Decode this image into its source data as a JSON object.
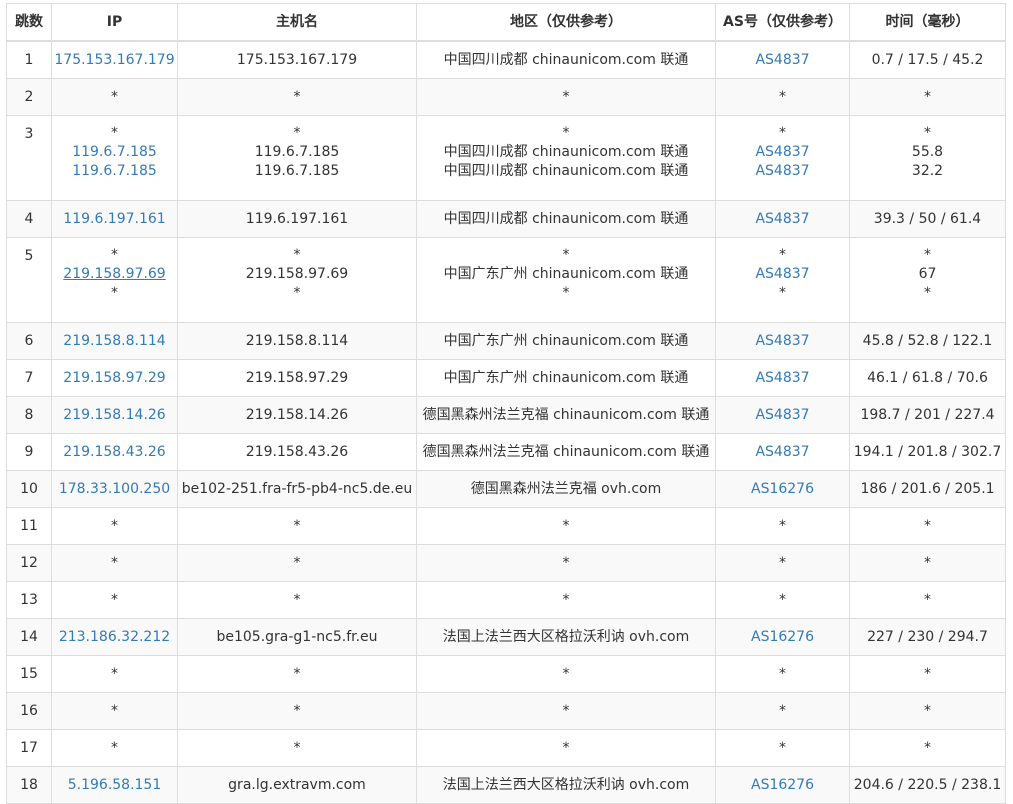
{
  "headers": {
    "hop": "跳数",
    "ip": "IP",
    "hostname": "主机名",
    "region": "地区（仅供参考）",
    "as": "AS号（仅供参考）",
    "time": "时间（毫秒）"
  },
  "colors": {
    "link": "#337ab7",
    "stripe": "#f9f9f9",
    "border": "#dddddd",
    "text": "#333333"
  },
  "rows": [
    {
      "hop": "1",
      "lines": [
        {
          "ip": "175.153.167.179",
          "host": "175.153.167.179",
          "region": "中国四川成都 chinaunicom.com 联通",
          "as": "AS4837",
          "time": "0.7 / 17.5 / 45.2"
        }
      ]
    },
    {
      "hop": "2",
      "lines": [
        {
          "ip": "*",
          "host": "*",
          "region": "*",
          "as": "*",
          "time": "*"
        }
      ]
    },
    {
      "hop": "3",
      "lines": [
        {
          "ip": "*",
          "host": "*",
          "region": "*",
          "as": "*",
          "time": "*"
        },
        {
          "ip": "119.6.7.185",
          "host": "119.6.7.185",
          "region": "中国四川成都 chinaunicom.com 联通",
          "as": "AS4837",
          "time": "55.8"
        },
        {
          "ip": "119.6.7.185",
          "host": "119.6.7.185",
          "region": "中国四川成都 chinaunicom.com 联通",
          "as": "AS4837",
          "time": "32.2"
        }
      ]
    },
    {
      "hop": "4",
      "lines": [
        {
          "ip": "119.6.197.161",
          "host": "119.6.197.161",
          "region": "中国四川成都 chinaunicom.com 联通",
          "as": "AS4837",
          "time": "39.3 / 50 / 61.4"
        }
      ]
    },
    {
      "hop": "5",
      "lines": [
        {
          "ip": "*",
          "host": "*",
          "region": "*",
          "as": "*",
          "time": "*"
        },
        {
          "ip": "219.158.97.69",
          "host": "219.158.97.69",
          "region": "中国广东广州 chinaunicom.com 联通",
          "as": "AS4837",
          "time": "67"
        },
        {
          "ip": "*",
          "host": "*",
          "region": "*",
          "as": "*",
          "time": "*"
        }
      ]
    },
    {
      "hop": "6",
      "lines": [
        {
          "ip": "219.158.8.114",
          "host": "219.158.8.114",
          "region": "中国广东广州 chinaunicom.com 联通",
          "as": "AS4837",
          "time": "45.8 / 52.8 / 122.1"
        }
      ]
    },
    {
      "hop": "7",
      "lines": [
        {
          "ip": "219.158.97.29",
          "host": "219.158.97.29",
          "region": "中国广东广州 chinaunicom.com 联通",
          "as": "AS4837",
          "time": "46.1 / 61.8 / 70.6"
        }
      ]
    },
    {
      "hop": "8",
      "lines": [
        {
          "ip": "219.158.14.26",
          "host": "219.158.14.26",
          "region": "德国黑森州法兰克福 chinaunicom.com 联通",
          "as": "AS4837",
          "time": "198.7 / 201 / 227.4"
        }
      ]
    },
    {
      "hop": "9",
      "lines": [
        {
          "ip": "219.158.43.26",
          "host": "219.158.43.26",
          "region": "德国黑森州法兰克福 chinaunicom.com 联通",
          "as": "AS4837",
          "time": "194.1 / 201.8 / 302.7"
        }
      ]
    },
    {
      "hop": "10",
      "lines": [
        {
          "ip": "178.33.100.250",
          "host": "be102-251.fra-fr5-pb4-nc5.de.eu",
          "region": "德国黑森州法兰克福 ovh.com",
          "as": "AS16276",
          "time": "186 / 201.6 / 205.1"
        }
      ]
    },
    {
      "hop": "11",
      "lines": [
        {
          "ip": "*",
          "host": "*",
          "region": "*",
          "as": "*",
          "time": "*"
        }
      ]
    },
    {
      "hop": "12",
      "lines": [
        {
          "ip": "*",
          "host": "*",
          "region": "*",
          "as": "*",
          "time": "*"
        }
      ]
    },
    {
      "hop": "13",
      "lines": [
        {
          "ip": "*",
          "host": "*",
          "region": "*",
          "as": "*",
          "time": "*"
        }
      ]
    },
    {
      "hop": "14",
      "lines": [
        {
          "ip": "213.186.32.212",
          "host": "be105.gra-g1-nc5.fr.eu",
          "region": "法国上法兰西大区格拉沃利讷 ovh.com",
          "as": "AS16276",
          "time": "227 / 230 / 294.7"
        }
      ]
    },
    {
      "hop": "15",
      "lines": [
        {
          "ip": "*",
          "host": "*",
          "region": "*",
          "as": "*",
          "time": "*"
        }
      ]
    },
    {
      "hop": "16",
      "lines": [
        {
          "ip": "*",
          "host": "*",
          "region": "*",
          "as": "*",
          "time": "*"
        }
      ]
    },
    {
      "hop": "17",
      "lines": [
        {
          "ip": "*",
          "host": "*",
          "region": "*",
          "as": "*",
          "time": "*"
        }
      ]
    },
    {
      "hop": "18",
      "lines": [
        {
          "ip": "5.196.58.151",
          "host": "gra.lg.extravm.com",
          "region": "法国上法兰西大区格拉沃利讷 ovh.com",
          "as": "AS16276",
          "time": "204.6 / 220.5 / 238.1"
        }
      ]
    }
  ]
}
